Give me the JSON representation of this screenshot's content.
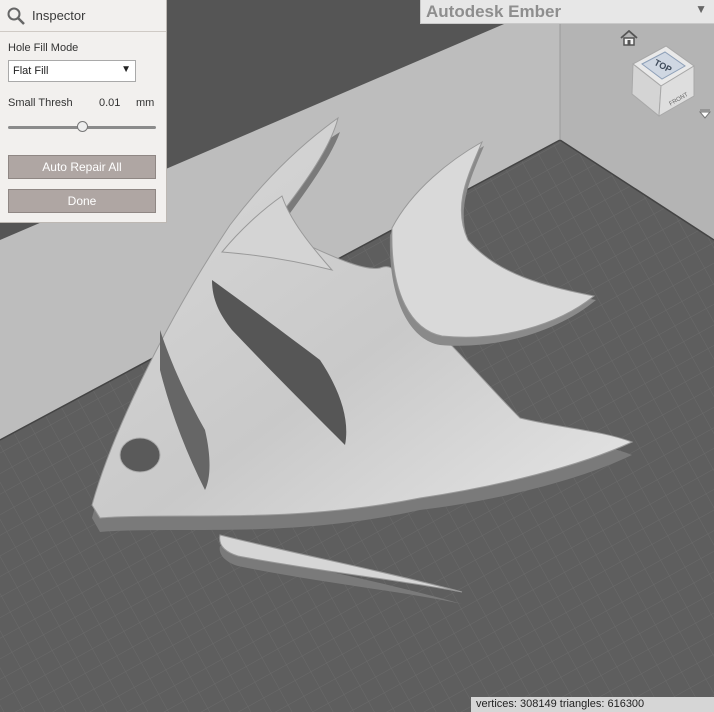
{
  "app": {
    "title": "Autodesk Ember",
    "menu_icon": "chevron-down-icon"
  },
  "inspector": {
    "title": "Inspector",
    "icon": "search-icon",
    "hole_fill_mode_label": "Hole Fill Mode",
    "hole_fill_mode_value": "Flat Fill",
    "small_thresh_label": "Small Thresh",
    "small_thresh_value": "0.01",
    "small_thresh_unit": "mm",
    "small_thresh_slider_fraction": 0.5,
    "auto_repair_label": "Auto Repair All",
    "done_label": "Done"
  },
  "viewcube": {
    "face_label": "TOP",
    "side_label": "FRONT"
  },
  "status": {
    "text": "vertices: 308149 triangles: 616300"
  }
}
